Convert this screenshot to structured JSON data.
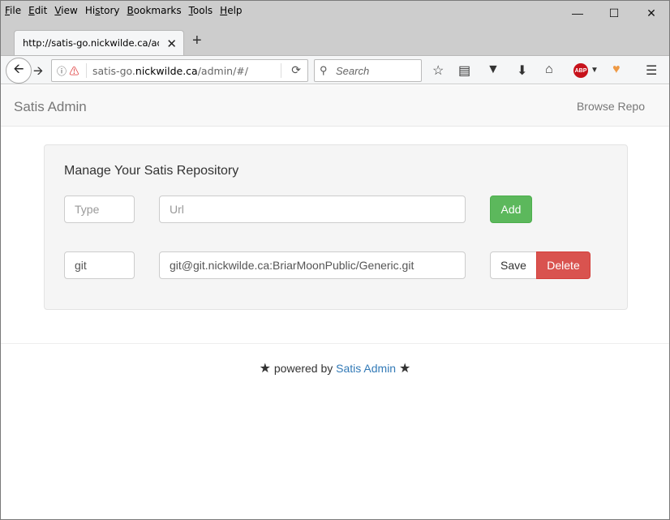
{
  "browser": {
    "menu": [
      "File",
      "Edit",
      "View",
      "History",
      "Bookmarks",
      "Tools",
      "Help"
    ],
    "menu_underline": [
      "F",
      "E",
      "V",
      "s",
      "B",
      "T",
      "H"
    ],
    "tab_title": "http://satis-go.nickwilde.ca/admin/#/",
    "url": {
      "prefix": "satis-go.",
      "host": "nickwilde.ca",
      "path": "/admin/#/"
    },
    "search_placeholder": "Search",
    "abp_label": "ABP"
  },
  "app": {
    "brand": "Satis Admin",
    "browse_link": "Browse Repo"
  },
  "panel": {
    "title": "Manage Your Satis Repository",
    "new_entry": {
      "type_placeholder": "Type",
      "url_placeholder": "Url",
      "add_label": "Add"
    },
    "repos": [
      {
        "type": "git",
        "url": "git@git.nickwilde.ca:BriarMoonPublic/Generic.git",
        "save_label": "Save",
        "delete_label": "Delete"
      }
    ]
  },
  "footer": {
    "prefix": "powered by",
    "link": "Satis Admin"
  },
  "colors": {
    "add": "#5cb85c",
    "delete": "#d9534f",
    "link": "#337ab7"
  }
}
